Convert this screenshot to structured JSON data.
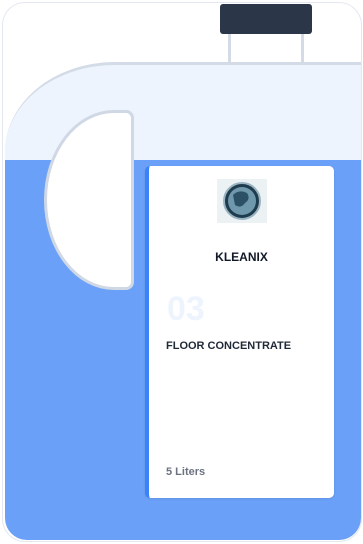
{
  "product_label": {
    "logo_icon": "globe-logo-icon",
    "brand": "KLEANIX",
    "number": "03",
    "product_name": "FLOOR CONCENTRATE",
    "volume": "5 Liters"
  },
  "colors": {
    "liquid": "#6aa0f7",
    "accent": "#3b82f6",
    "cap": "#2b3649"
  }
}
